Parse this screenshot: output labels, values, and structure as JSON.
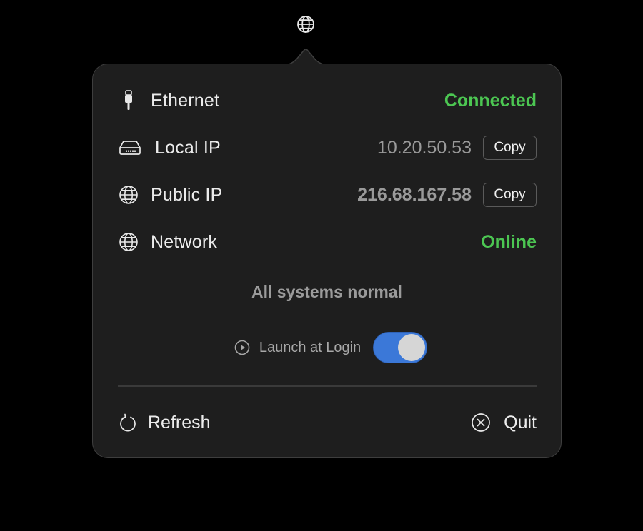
{
  "menubar": {
    "icon": "globe-icon"
  },
  "rows": [
    {
      "icon": "ethernet-plug-icon",
      "label": "Ethernet",
      "value": "Connected",
      "value_color": "#4cc652"
    },
    {
      "icon": "network-drive-icon",
      "label": "Local IP",
      "value": "10.20.50.53",
      "copy_label": "Copy"
    },
    {
      "icon": "globe-icon",
      "label": "Public IP",
      "value": "216.68.167.58",
      "copy_label": "Copy"
    },
    {
      "icon": "globe-icon",
      "label": "Network",
      "value": "Online",
      "value_color": "#4cc652"
    }
  ],
  "system_status": "All systems normal",
  "launch_at_login": {
    "icon": "play-circle-icon",
    "label": "Launch at Login",
    "enabled": true,
    "accent": "#3b78d8"
  },
  "footer": {
    "refresh": {
      "icon": "refresh-icon",
      "label": "Refresh"
    },
    "quit": {
      "icon": "close-circle-icon",
      "label": "Quit"
    }
  }
}
